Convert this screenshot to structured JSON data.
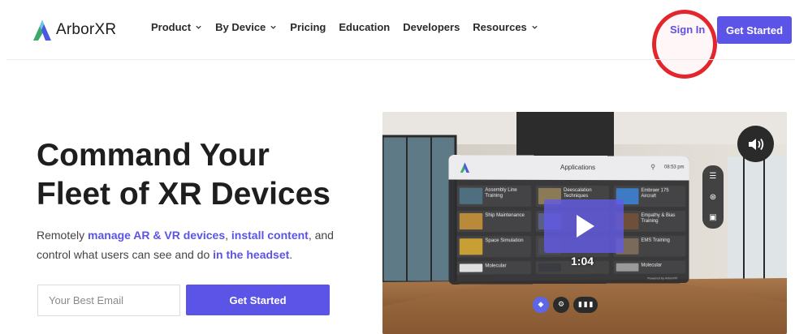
{
  "header": {
    "logo_text": "ArborXR",
    "nav": [
      {
        "label": "Product",
        "has_dropdown": true
      },
      {
        "label": "By Device",
        "has_dropdown": true
      },
      {
        "label": "Pricing",
        "has_dropdown": false
      },
      {
        "label": "Education",
        "has_dropdown": false
      },
      {
        "label": "Developers",
        "has_dropdown": false
      },
      {
        "label": "Resources",
        "has_dropdown": true
      }
    ],
    "signin_label": "Sign In",
    "get_started_label": "Get Started"
  },
  "hero": {
    "title_line1": "Command Your",
    "title_line2": "Fleet of XR Devices",
    "subtitle": {
      "part1": "Remotely ",
      "hl1": "manage AR & VR devices",
      "part2": ", ",
      "hl2": "install content",
      "part3": ", and control what users can see and do ",
      "hl3": "in the headset",
      "part4": "."
    },
    "email_placeholder": "Your Best Email",
    "email_value": "",
    "cta_label": "Get Started"
  },
  "video": {
    "panel_title": "Applications",
    "panel_time": "08:53 pm",
    "apps": [
      {
        "label": "Assembly Line Training"
      },
      {
        "label": "Deescalation Techniques"
      },
      {
        "label": "Embraer 175 Aircraft"
      },
      {
        "label": "Ship Maintenance"
      },
      {
        "label": ""
      },
      {
        "label": "Empathy & Bias Training"
      },
      {
        "label": "Space Simulation"
      },
      {
        "label": ""
      },
      {
        "label": "EMS Training"
      },
      {
        "label": "Molecular"
      },
      {
        "label": ""
      },
      {
        "label": "Molecular"
      }
    ],
    "powered_by": "Powered by ArborXR",
    "duration": "1:04"
  },
  "colors": {
    "accent": "#5b54e6",
    "annotation": "#e2262c"
  },
  "icons": {
    "volume": "speaker-volume-icon",
    "play": "play-icon"
  }
}
